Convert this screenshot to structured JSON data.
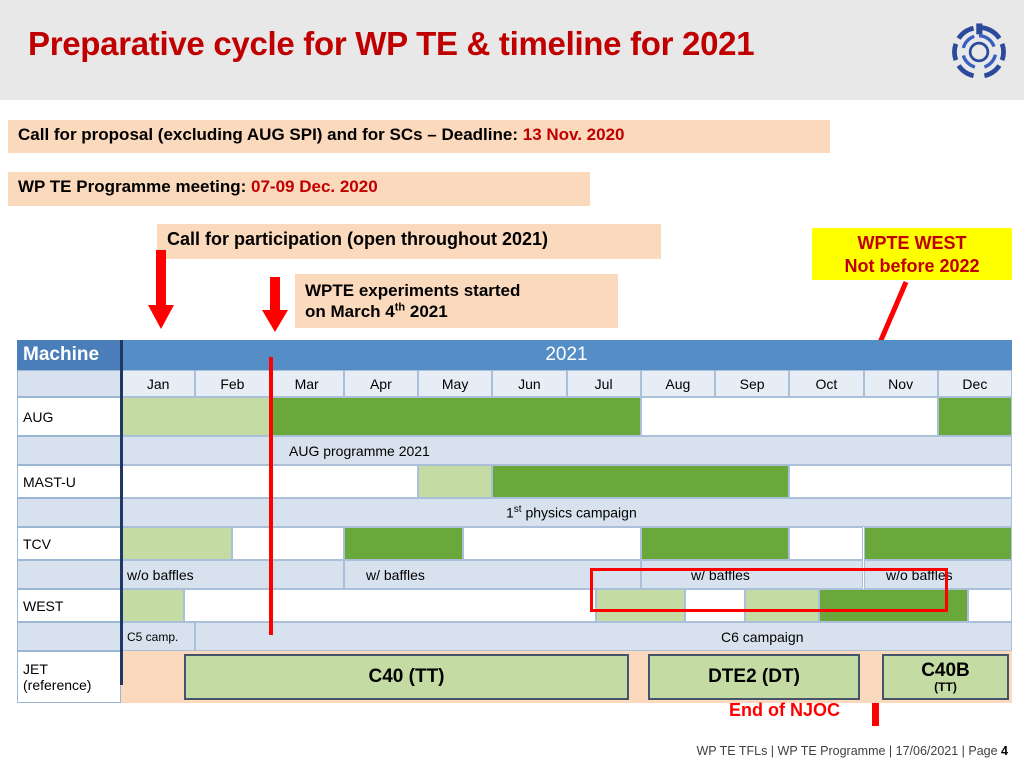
{
  "header": {
    "title": "Preparative cycle for WP TE & timeline for 2021",
    "logo_name": "eurofusion-logo",
    "bg": "#e8e8e8",
    "title_color": "#c00000"
  },
  "callouts": [
    {
      "id": "proposal",
      "text_black": "Call for proposal (excluding AUG SPI) and for SCs – Deadline: ",
      "text_red": "13 Nov. 2020",
      "bg": "#fbd9bd"
    },
    {
      "id": "meeting",
      "text_black": "WP TE Programme meeting: ",
      "text_red": "07-09 Dec. 2020",
      "bg": "#fbd9bd"
    },
    {
      "id": "participation",
      "text_black": "Call for participation (open throughout 2021)",
      "text_red": "",
      "bg": "#fbd9bd"
    },
    {
      "id": "experiments",
      "line1": "WPTE experiments started",
      "line2_pre": "on March 4",
      "line2_sup": "th",
      "line2_post": " 2021",
      "bg": "#fbd9bd"
    }
  ],
  "west_note": {
    "line1": "WPTE WEST",
    "line2": "Not before 2022",
    "bg": "#ffff00",
    "color": "#c00000"
  },
  "chart_data": {
    "type": "table",
    "title": "2021",
    "machine_header": "Machine",
    "categories": [
      "Jan",
      "Feb",
      "Mar",
      "Apr",
      "May",
      "Jun",
      "Jul",
      "Aug",
      "Sep",
      "Oct",
      "Nov",
      "Dec"
    ],
    "colors": {
      "light_green": "#c5dba4",
      "dark_green": "#6aa83c",
      "peach": "#fbd9bd",
      "white": "#ffffff",
      "header_blue": "#558ec6",
      "sub_blue": "#d8e2ee",
      "red_marker": "#ff0000"
    },
    "marker_line": {
      "label": "March 4th 2021 start",
      "after_month": "Feb"
    },
    "rows": [
      {
        "machine": "AUG",
        "bars": [
          {
            "start": 0,
            "end": 2,
            "color": "light_green"
          },
          {
            "start": 2,
            "end": 7,
            "color": "dark_green"
          },
          {
            "start": 7,
            "end": 11,
            "color": "white"
          },
          {
            "start": 11,
            "end": 12,
            "color": "dark_green"
          }
        ],
        "sublabel": "AUG programme 2021",
        "sublabel_start": 2
      },
      {
        "machine": "MAST-U",
        "bars": [
          {
            "start": 0,
            "end": 4,
            "color": "white"
          },
          {
            "start": 4,
            "end": 5,
            "color": "light_green"
          },
          {
            "start": 5,
            "end": 9,
            "color": "dark_green"
          },
          {
            "start": 9,
            "end": 12,
            "color": "white"
          }
        ],
        "sublabel": "1st physics campaign",
        "sublabel_start": 4
      },
      {
        "machine": "TCV",
        "bars": [
          {
            "start": 0,
            "end": 1.5,
            "color": "light_green"
          },
          {
            "start": 1.5,
            "end": 3,
            "color": "white"
          },
          {
            "start": 3,
            "end": 4.6,
            "color": "dark_green"
          },
          {
            "start": 4.6,
            "end": 7,
            "color": "white"
          },
          {
            "start": 7,
            "end": 9,
            "color": "dark_green"
          },
          {
            "start": 9,
            "end": 10,
            "color": "white"
          },
          {
            "start": 10,
            "end": 12,
            "color": "dark_green"
          }
        ],
        "sublabels": [
          {
            "text": "w/o baffles",
            "start": 0
          },
          {
            "text": "w/ baffles",
            "start": 3
          },
          {
            "text": "w/ baffles",
            "start": 7.1
          },
          {
            "text": "w/o baffles",
            "start": 10
          }
        ]
      },
      {
        "machine": "WEST",
        "bars": [
          {
            "start": 0,
            "end": 0.85,
            "color": "light_green"
          },
          {
            "start": 0.85,
            "end": 6.4,
            "color": "white"
          },
          {
            "start": 6.4,
            "end": 7.6,
            "color": "light_green"
          },
          {
            "start": 7.6,
            "end": 8.4,
            "color": "white"
          },
          {
            "start": 8.4,
            "end": 9.4,
            "color": "light_green"
          },
          {
            "start": 9.4,
            "end": 11.4,
            "color": "dark_green"
          },
          {
            "start": 11.4,
            "end": 12,
            "color": "white"
          }
        ],
        "sublabels": [
          {
            "text": "C5 camp.",
            "start": 0
          },
          {
            "text": "C6 campaign",
            "start": 7.3
          }
        ]
      },
      {
        "machine_line1": "JET",
        "machine_line2": "(reference)",
        "bars": [
          {
            "start": 0,
            "end": 0.85,
            "color": "peach"
          }
        ],
        "boxes": [
          {
            "label": "C40 (TT)",
            "sub": "",
            "start": 0.85,
            "end": 6.85
          },
          {
            "label": "DTE2 (DT)",
            "sub": "",
            "start": 7.1,
            "end": 9.95
          },
          {
            "label": "C40B",
            "sub": "(TT)",
            "start": 10.25,
            "end": 11.95
          }
        ]
      }
    ]
  },
  "annotations": {
    "end_of_njoc": "End of NJOC",
    "highlight_color": "#ff0000"
  },
  "footer": {
    "part1": "WP TE TFLs |",
    "part2": "WP TE Programme | 17/06/2021 | Page ",
    "page": "4"
  }
}
